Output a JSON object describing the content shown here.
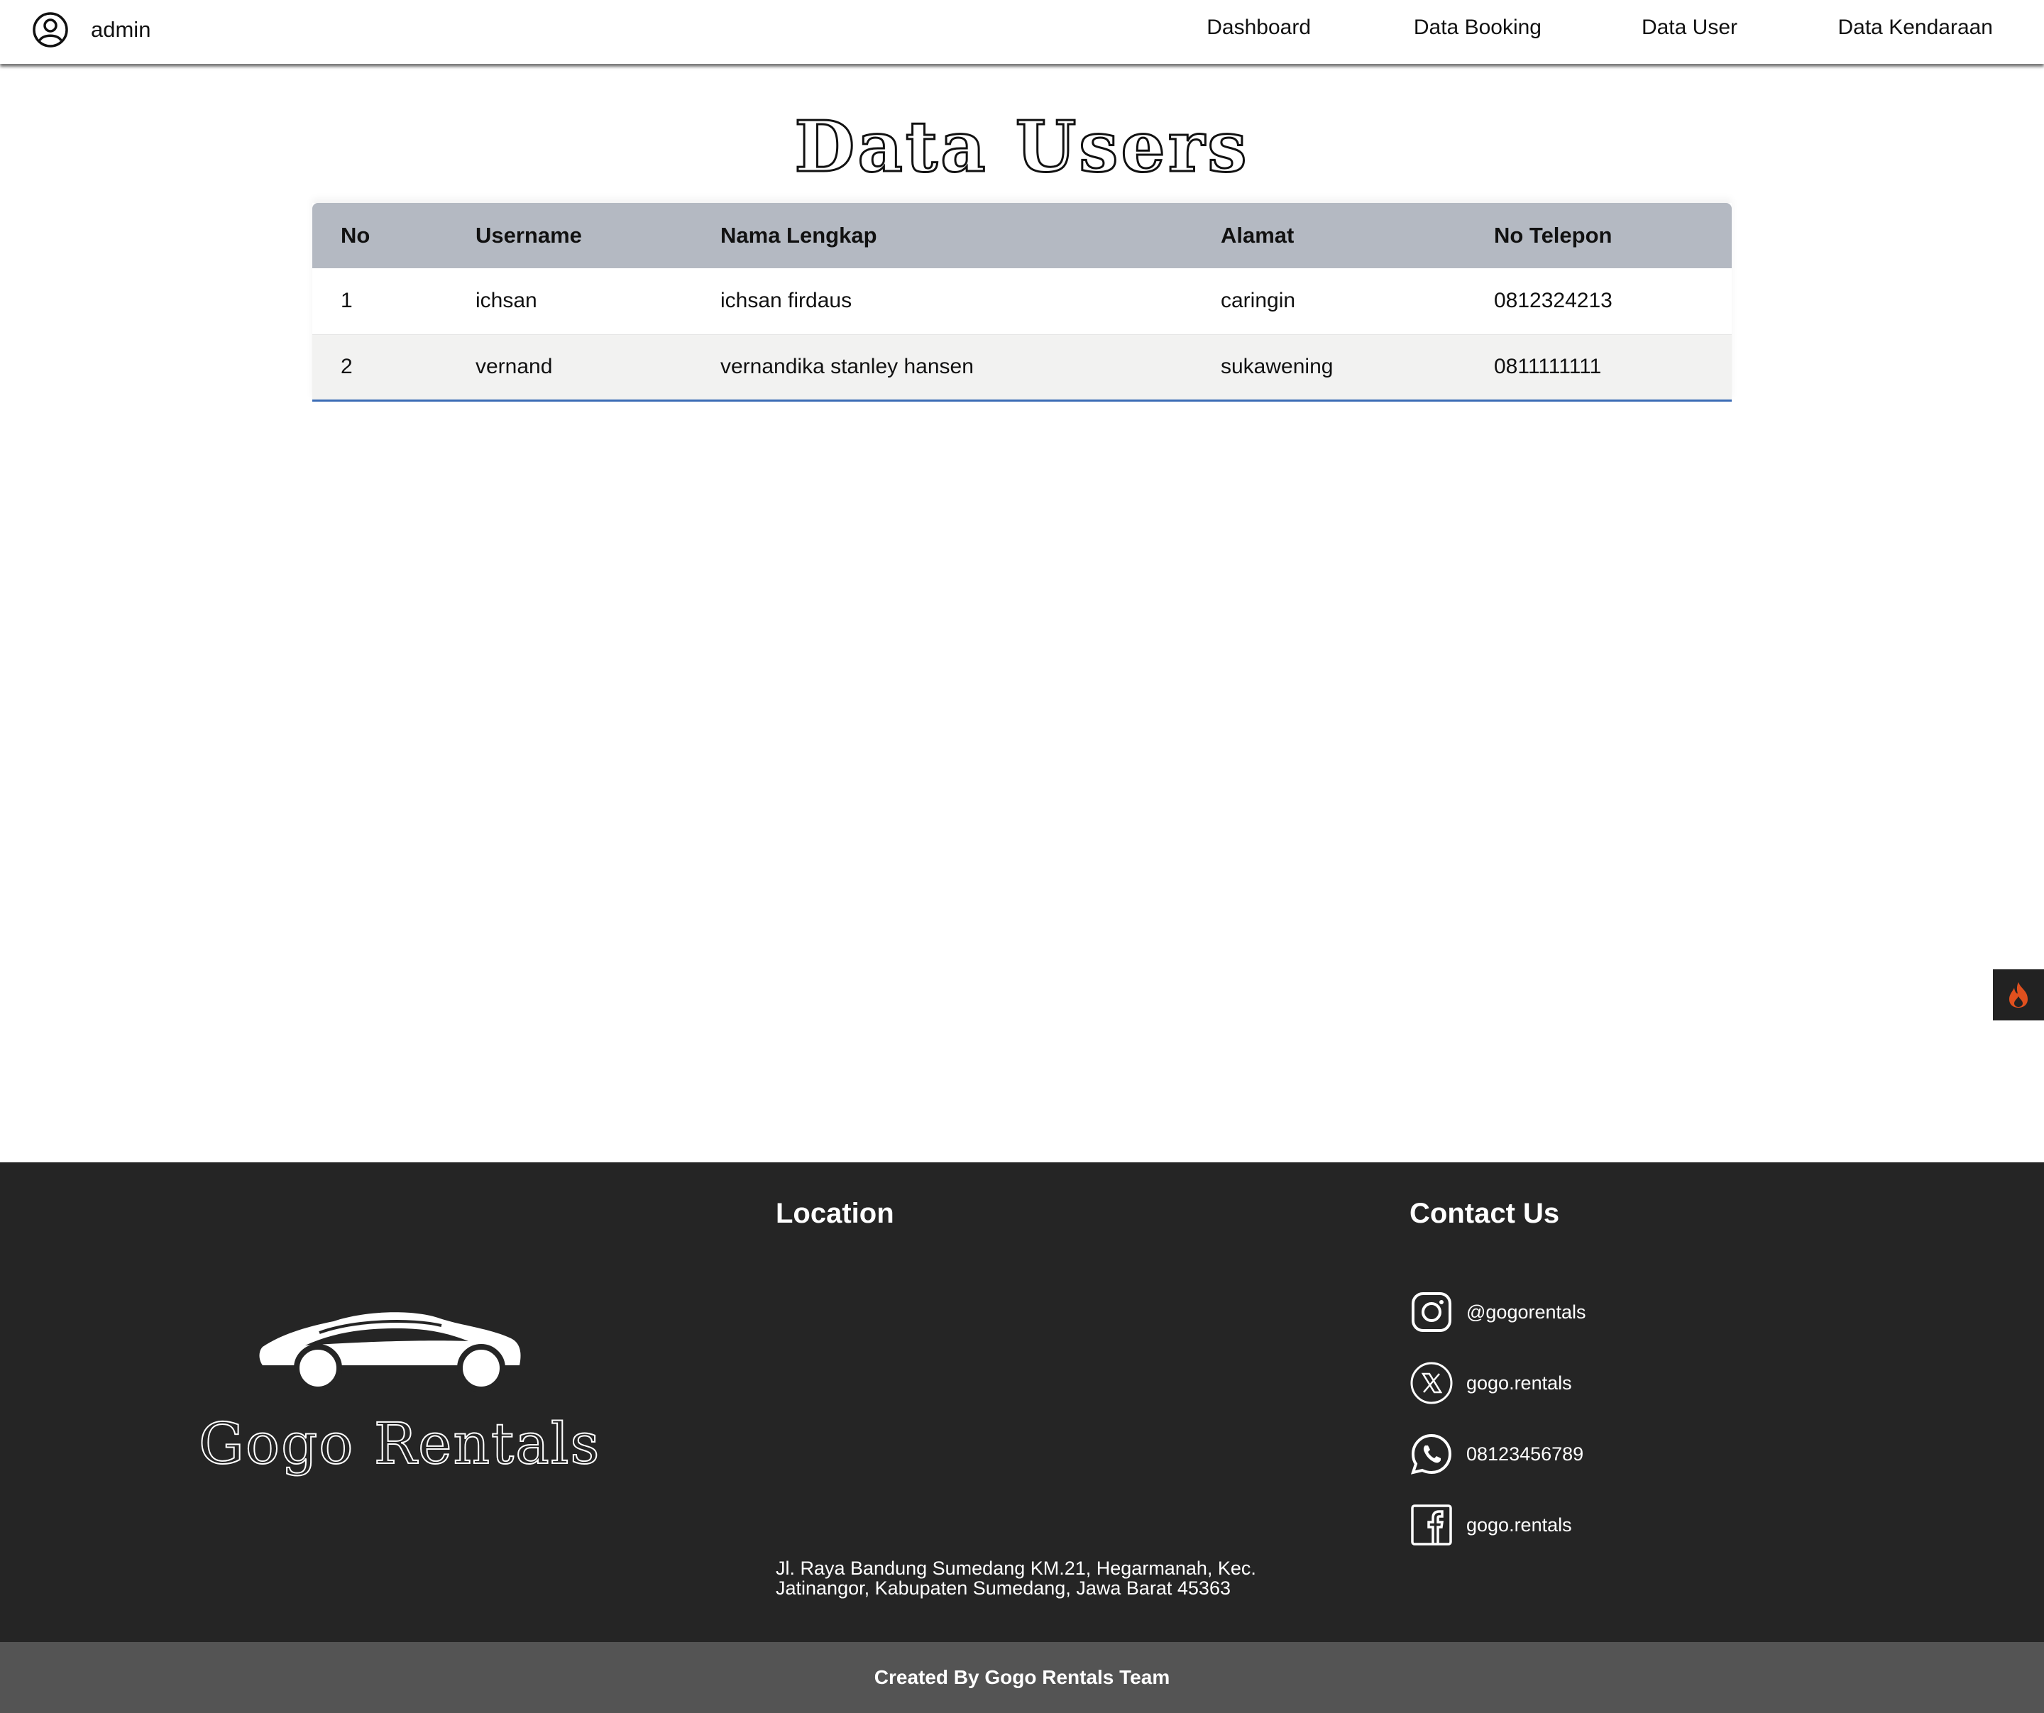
{
  "nav": {
    "user_label": "admin",
    "links": [
      "Dashboard",
      "Data Booking",
      "Data User",
      "Data Kendaraan"
    ]
  },
  "page": {
    "title": "Data Users"
  },
  "table": {
    "headers": [
      "No",
      "Username",
      "Nama Lengkap",
      "Alamat",
      "No Telepon"
    ],
    "rows": [
      [
        "1",
        "ichsan",
        "ichsan firdaus",
        "caringin",
        "0812324213"
      ],
      [
        "2",
        "vernand",
        "vernandika stanley hansen",
        "sukawening",
        "0811111111"
      ]
    ]
  },
  "footer": {
    "brand": "Gogo Rentals",
    "location_title": "Location",
    "address_line1": "Jl. Raya Bandung Sumedang KM.21, Hegarmanah, Kec.",
    "address_line2": "Jatinangor, Kabupaten Sumedang, Jawa Barat 45363",
    "contact_title": "Contact Us",
    "contacts": [
      {
        "icon": "instagram-icon",
        "text": "@gogorentals"
      },
      {
        "icon": "x-twitter-icon",
        "text": "gogo.rentals"
      },
      {
        "icon": "whatsapp-icon",
        "text": "08123456789"
      },
      {
        "icon": "facebook-icon",
        "text": "gogo.rentals"
      }
    ],
    "credit": "Created By Gogo Rentals Team"
  },
  "colors": {
    "table_header_bg": "#b4b9c2",
    "table_row_alt_bg": "#f2f2f1",
    "table_bottom_border": "#3b6cb5",
    "footer_bg": "#252525",
    "credit_bar_bg": "#545454",
    "side_tab_bg": "#222222",
    "flame_color": "#e0501e"
  },
  "side_tab": {
    "icon": "flame-icon"
  }
}
